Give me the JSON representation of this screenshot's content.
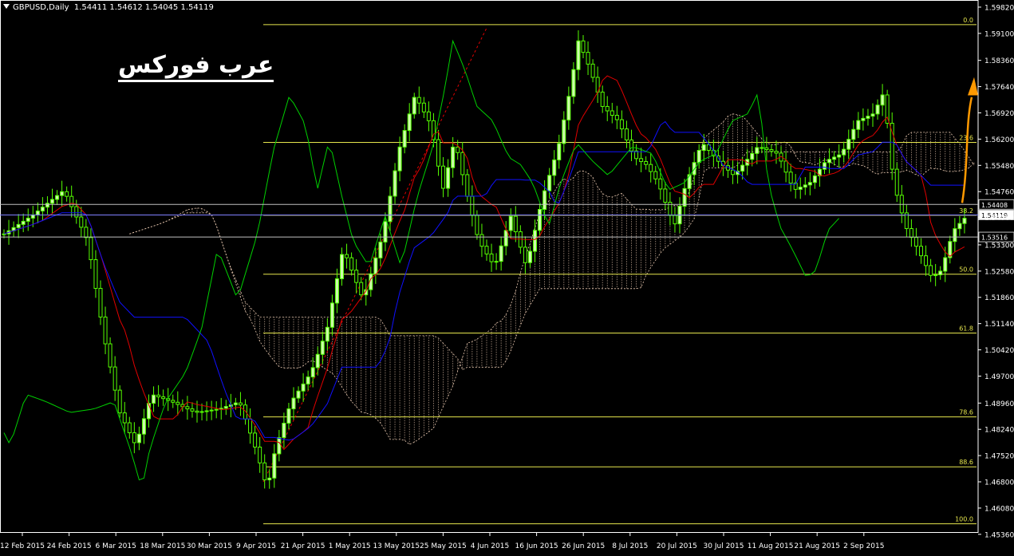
{
  "header": {
    "symbol": "GBPUSD,Daily",
    "ohlc": "1.54411 1.54612 1.54045 1.54119"
  },
  "brand": "عرب فوركس",
  "chart_data": {
    "type": "candlestick",
    "symbol": "GBPUSD",
    "timeframe": "Daily",
    "ylim": [
      1.454,
      1.5995
    ],
    "y_ticks": [
      "1.59820",
      "1.59100",
      "1.58360",
      "1.57640",
      "1.56920",
      "1.56200",
      "1.55480",
      "1.54760",
      "1.54060",
      "1.53300",
      "1.52580",
      "1.51860",
      "1.51140",
      "1.50420",
      "1.49700",
      "1.48960",
      "1.48240",
      "1.47520",
      "1.46800",
      "1.46080",
      "1.45360"
    ],
    "x_ticks": [
      "12 Feb 2015",
      "24 Feb 2015",
      "6 Mar 2015",
      "18 Mar 2015",
      "30 Mar 2015",
      "9 Apr 2015",
      "21 Apr 2015",
      "1 May 2015",
      "13 May 2015",
      "25 May 2015",
      "4 Jun 2015",
      "16 Jun 2015",
      "26 Jun 2015",
      "8 Jul 2015",
      "20 Jul 2015",
      "30 Jul 2015",
      "11 Aug 2015",
      "21 Aug 2015",
      "2 Sep 2015"
    ],
    "price_labels": [
      {
        "value": 1.54408,
        "text": "1.54408"
      },
      {
        "value": 1.54119,
        "text": "1.54119"
      },
      {
        "value": 1.53516,
        "text": "1.53516"
      }
    ],
    "fibonacci": {
      "top": 1.5934,
      "bottom": 1.4565,
      "levels": [
        {
          "ratio": 0.0,
          "label": "0.0"
        },
        {
          "ratio": 0.236,
          "label": "23.6"
        },
        {
          "ratio": 0.382,
          "label": "38.2"
        },
        {
          "ratio": 0.5,
          "label": "50.0"
        },
        {
          "ratio": 0.618,
          "label": "61.8"
        },
        {
          "ratio": 0.786,
          "label": "78.6"
        },
        {
          "ratio": 0.886,
          "label": "88.6"
        },
        {
          "ratio": 1.0,
          "label": "100.0"
        }
      ]
    },
    "colors": {
      "background": "#000000",
      "bull": "#ccffaa",
      "bear": "#55ff00",
      "fib": "#e6e64d",
      "tenkan": "#e00000",
      "kijun": "#1010ff",
      "chikou": "#00d000",
      "cloud": "#e8c8b0",
      "arrow": "#ff9900",
      "trendline": "#e00000",
      "axis_text": "#ffffff"
    }
  }
}
